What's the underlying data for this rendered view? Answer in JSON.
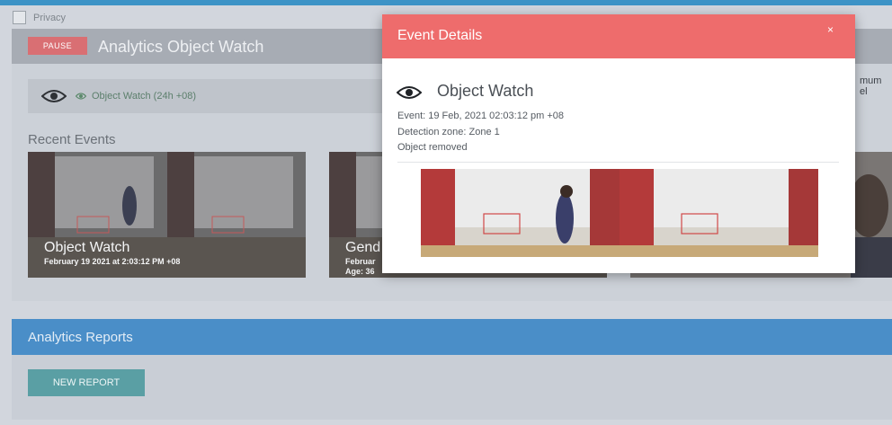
{
  "privacy": {
    "label": "Privacy"
  },
  "header": {
    "pause_label": "PAUSE",
    "title": "Analytics Object Watch"
  },
  "watch": {
    "label": "Object Watch (24h  +08)",
    "truncated_right": "mum el"
  },
  "recent": {
    "title": "Recent Events",
    "cards": [
      {
        "title": "Object Watch",
        "subtitle": "February 19 2021 at 2:03:12 PM +08"
      },
      {
        "title": "Gend",
        "subtitle": "Februar",
        "subtitle2": "Age: 36"
      }
    ]
  },
  "reports": {
    "title": "Analytics Reports",
    "new_report_label": "NEW REPORT"
  },
  "modal": {
    "title": "Event Details",
    "close_label": "×",
    "event_title": "Object Watch",
    "event_line": "Event: 19 Feb, 2021 02:03:12 pm +08",
    "zone_line": "Detection zone: Zone 1",
    "status_line": "Object removed"
  },
  "colors": {
    "topbar": "#3d93c6",
    "modal_header": "#ee6c6c",
    "reports_header": "#4a8ec8",
    "new_report": "#5a9fa4",
    "pause": "#d96f73"
  },
  "icons": {
    "eye": "eye-icon",
    "small_eye": "eye-outline-icon",
    "close": "close-icon"
  }
}
